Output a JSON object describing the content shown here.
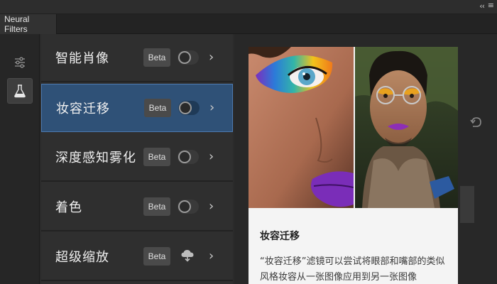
{
  "window": {
    "collapse_icon": "double-chevron-left-icon",
    "menu_icon": "hamburger-menu-icon"
  },
  "tabs": [
    {
      "label": "Neural Filters"
    }
  ],
  "rail": {
    "items": [
      {
        "icon": "sliders-icon",
        "active": false
      },
      {
        "icon": "flask-icon",
        "active": true
      }
    ]
  },
  "filters": [
    {
      "label": "智能肖像",
      "badge": "Beta",
      "control": "toggle",
      "enabled": false,
      "selected": false
    },
    {
      "label": "妆容迁移",
      "badge": "Beta",
      "control": "toggle",
      "enabled": false,
      "selected": true
    },
    {
      "label": "深度感知雾化",
      "badge": "Beta",
      "control": "toggle",
      "enabled": false,
      "selected": false
    },
    {
      "label": "着色",
      "badge": "Beta",
      "control": "toggle",
      "enabled": false,
      "selected": false
    },
    {
      "label": "超级缩放",
      "badge": "Beta",
      "control": "cloud-download",
      "enabled": false,
      "selected": false
    }
  ],
  "preview": {
    "title": "妆容迁移",
    "description": "“妆容迁移”滤镜可以尝试将眼部和嘴部的类似风格妆容从一张图像应用到另一张图像"
  },
  "colors": {
    "selected_row": "#2f5177",
    "selected_border": "#4d7ab0",
    "panel_bg": "#2f2f2f",
    "card_bg": "#f4f4f4"
  }
}
